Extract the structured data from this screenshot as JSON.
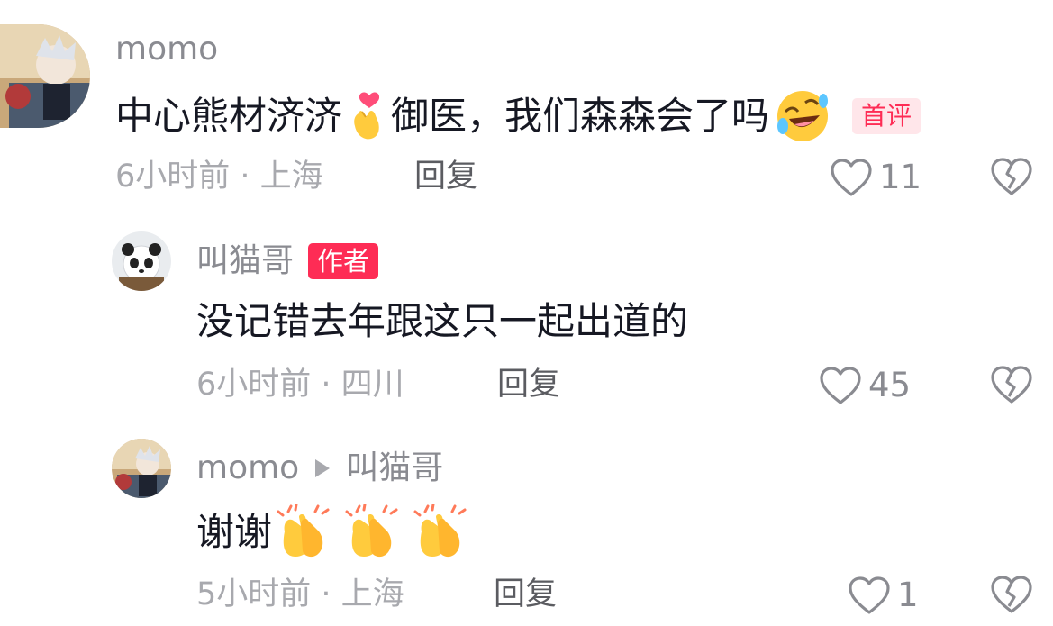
{
  "comments": [
    {
      "username": "momo",
      "content_text": "中心熊材济济",
      "content_text2": "御医，我们森森会了吗",
      "first_badge": "首评",
      "time_location": "6小时前 · 上海",
      "reply_label": "回复",
      "likes": "11",
      "emojis": [
        "heart-finger-emoji",
        "rolling-laughing-emoji"
      ]
    },
    {
      "username": "叫猫哥",
      "author_badge": "作者",
      "content_text": "没记错去年跟这只一起出道的",
      "time_location": "6小时前 · 四川",
      "reply_label": "回复",
      "likes": "45"
    },
    {
      "username": "momo",
      "reply_to": "叫猫哥",
      "content_text": "谢谢",
      "time_location": "5小时前 · 上海",
      "reply_label": "回复",
      "likes": "1",
      "emojis": [
        "clapping-hands-emoji",
        "clapping-hands-emoji",
        "clapping-hands-emoji"
      ]
    }
  ],
  "colors": {
    "accent": "#fe2c55",
    "muted_text": "#a8a9ae",
    "username_text": "#8a8b91",
    "main_text": "#161823"
  }
}
